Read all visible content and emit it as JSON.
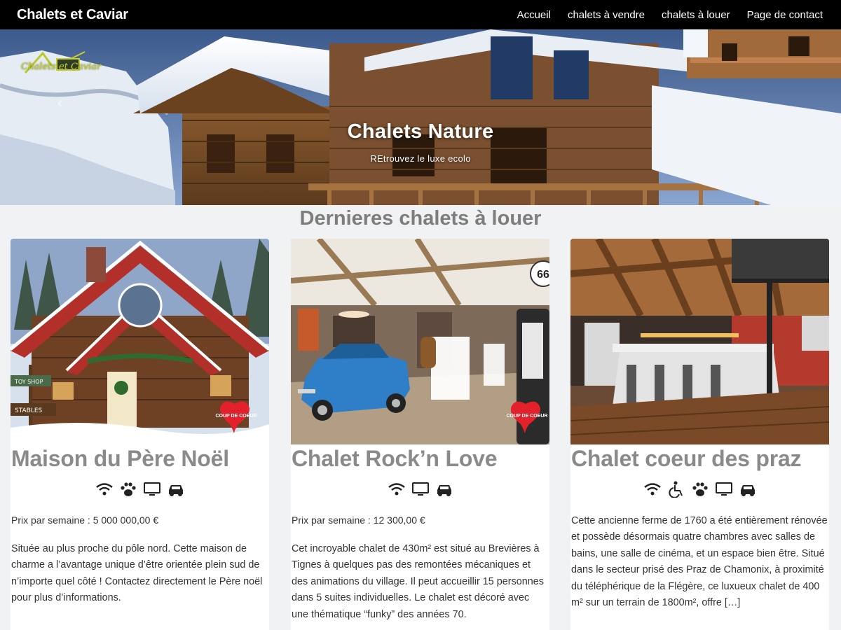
{
  "navbar": {
    "brand": "Chalets et Caviar",
    "links": [
      "Accueil",
      "chalets à vendre",
      "chalets à louer",
      "Page de contact"
    ]
  },
  "hero": {
    "title": "Chalets Nature",
    "subtitle": "REtrouvez le luxe ecolo",
    "logo_text": "Chalets et Caviar"
  },
  "section": {
    "title": "Dernieres chalets à louer"
  },
  "cards": [
    {
      "title": "Maison du Père Noël",
      "icons": [
        "wifi-icon",
        "paw-icon",
        "tv-icon",
        "car-icon"
      ],
      "price": "Prix par semaine : 5 000 000,00 €",
      "description": "Située au plus proche du pôle nord. Cette maison de charme a l’avantage unique d’être orientée plein sud de n’importe quel côté ! Contactez directement le Père noël pour plus d’informations.",
      "badge": "COUP DE COEUR",
      "sign_labels": [
        "TOY SHOP",
        "STABLES"
      ]
    },
    {
      "title": "Chalet Rock’n Love",
      "icons": [
        "wifi-icon",
        "tv-icon",
        "car-icon"
      ],
      "price": "Prix par semaine : 12 300,00 €",
      "description": "Cet incroyable chalet de 430m² est situé au Brevières à Tignes à quelques pas des remontées mécaniques et des animations du village. Il peut accueillir 15 personnes dans 5 suites individuelles. Le chalet est décoré avec une thématique “funky” des années 70.",
      "badge": "COUP DE COEUR",
      "pump_label": "66"
    },
    {
      "title": "Chalet coeur des praz",
      "icons": [
        "wifi-icon",
        "wheelchair-icon",
        "paw-icon",
        "tv-icon",
        "car-icon"
      ],
      "price": "",
      "description": "Cette ancienne ferme de 1760 a été entièrement rénovée et possède désormais quatre chambres avec salles de bains, une salle de cinéma, et un espace bien être. Situé dans le secteur prisé des Praz de Chamonix, à proximité du téléphérique de la Flégère, ce luxueux chalet de 400 m² sur un terrain de 1800m², offre […]"
    }
  ],
  "colors": {
    "navbar": "#000000",
    "page_bg": "#f1f2f4",
    "heading_gray": "#7d7d7d",
    "badge_red": "#e3212b"
  }
}
